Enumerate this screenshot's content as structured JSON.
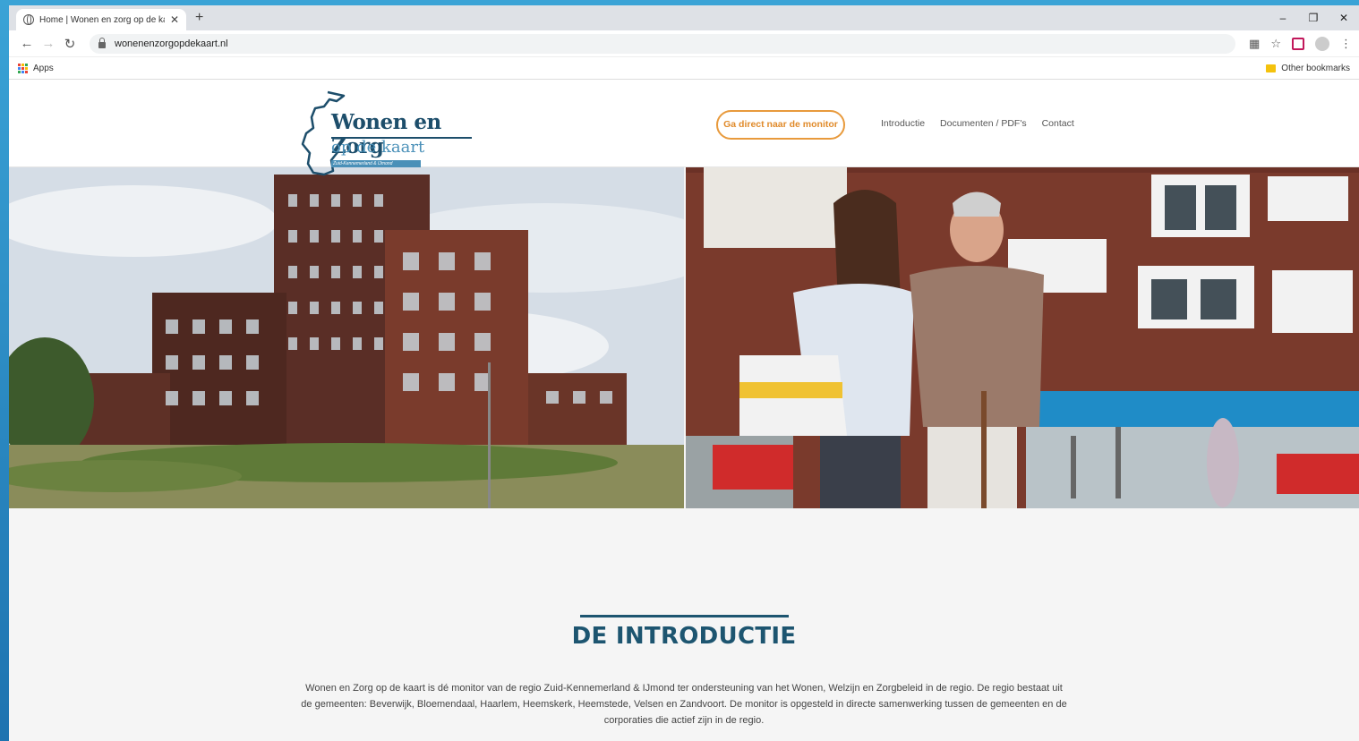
{
  "browser": {
    "tab_title": "Home | Wonen en zorg op de ka",
    "url": "wonenenzorgopdekaart.nl",
    "bookmarks": {
      "apps_label": "Apps",
      "other_label": "Other bookmarks"
    }
  },
  "site": {
    "logo": {
      "line1": "Wonen en Zorg",
      "line2": "op de kaart",
      "tagline": "Zuid-Kennemerland & IJmond"
    },
    "cta_label": "Ga direct naar de monitor",
    "nav": [
      "Introductie",
      "Documenten / PDF's",
      "Contact"
    ]
  },
  "intro": {
    "title": "DE INTRODUCTIE",
    "body": "Wonen en Zorg op de kaart is dé monitor van de regio Zuid-Kennemerland & IJmond ter ondersteuning van het Wonen, Welzijn en Zorgbeleid in de regio. De regio bestaat uit de gemeenten: Beverwijk, Bloemendaal, Haarlem, Heemskerk, Heemstede, Velsen en Zandvoort. De monitor is opgesteld in directe samenwerking tussen de gemeenten en de corporaties die actief zijn in de regio."
  },
  "colors": {
    "accent_orange": "#e89a3c",
    "brand_blue": "#1d5570",
    "logo_blue": "#4a90b8"
  }
}
